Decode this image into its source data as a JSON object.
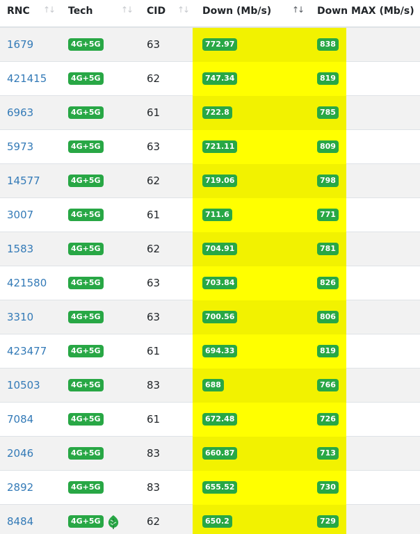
{
  "header": {
    "rnc": "RNC",
    "tech": "Tech",
    "cid": "CID",
    "down": "Down (Mb/s)",
    "down_max": "Down MAX (Mb/s)",
    "sort_inactive": "↑↓",
    "sort_active": "↑↓"
  },
  "colors": {
    "link": "#337ab7",
    "badge": "#28a745",
    "highlight": "#ffff00"
  },
  "rows": [
    {
      "rnc": "1679",
      "tech": "4G+5G",
      "cid": "63",
      "down": "772.97",
      "down_max": "838"
    },
    {
      "rnc": "421415",
      "tech": "4G+5G",
      "cid": "62",
      "down": "747.34",
      "down_max": "819"
    },
    {
      "rnc": "6963",
      "tech": "4G+5G",
      "cid": "61",
      "down": "722.8",
      "down_max": "785"
    },
    {
      "rnc": "5973",
      "tech": "4G+5G",
      "cid": "63",
      "down": "721.11",
      "down_max": "809"
    },
    {
      "rnc": "14577",
      "tech": "4G+5G",
      "cid": "62",
      "down": "719.06",
      "down_max": "798"
    },
    {
      "rnc": "3007",
      "tech": "4G+5G",
      "cid": "61",
      "down": "711.6",
      "down_max": "771"
    },
    {
      "rnc": "1583",
      "tech": "4G+5G",
      "cid": "62",
      "down": "704.91",
      "down_max": "781"
    },
    {
      "rnc": "421580",
      "tech": "4G+5G",
      "cid": "63",
      "down": "703.84",
      "down_max": "826"
    },
    {
      "rnc": "3310",
      "tech": "4G+5G",
      "cid": "63",
      "down": "700.56",
      "down_max": "806"
    },
    {
      "rnc": "423477",
      "tech": "4G+5G",
      "cid": "61",
      "down": "694.33",
      "down_max": "819"
    },
    {
      "rnc": "10503",
      "tech": "4G+5G",
      "cid": "83",
      "down": "688",
      "down_max": "766"
    },
    {
      "rnc": "7084",
      "tech": "4G+5G",
      "cid": "61",
      "down": "672.48",
      "down_max": "726"
    },
    {
      "rnc": "2046",
      "tech": "4G+5G",
      "cid": "83",
      "down": "660.87",
      "down_max": "713"
    },
    {
      "rnc": "2892",
      "tech": "4G+5G",
      "cid": "83",
      "down": "655.52",
      "down_max": "730"
    },
    {
      "rnc": "8484",
      "tech": "4G+5G",
      "cid": "62",
      "down": "650.2",
      "down_max": "729",
      "icon": "green-leaf-icon"
    }
  ]
}
